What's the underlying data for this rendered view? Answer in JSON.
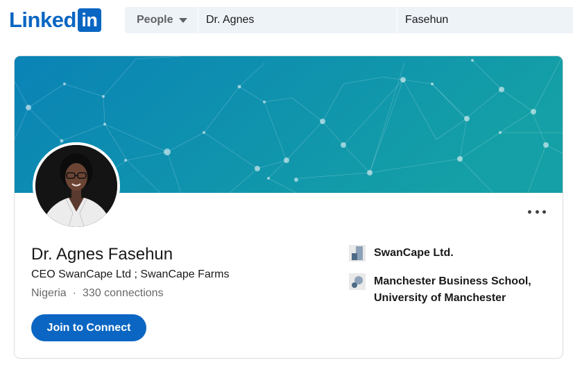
{
  "colors": {
    "brand": "#0a66c2",
    "search_bg": "#eef3f8",
    "banner_dark": "#0a83b6",
    "banner_light": "#14a0a6"
  },
  "header": {
    "logo_word": "Linked",
    "logo_box": "in",
    "search": {
      "category": "People",
      "first_name": "Dr. Agnes",
      "last_name": "Fasehun"
    }
  },
  "profile": {
    "name": "Dr. Agnes Fasehun",
    "headline": "CEO SwanCape Ltd ; SwanCape Farms",
    "location": "Nigeria",
    "separator": "·",
    "connections": "330 connections",
    "join_label": "Join to Connect",
    "more_icon": "ellipsis-icon"
  },
  "experience": [
    {
      "label": "SwanCape Ltd.",
      "icon": "company-logo-icon"
    },
    {
      "label_line1": "Manchester Business School,",
      "label_line2": "University of Manchester",
      "icon": "school-logo-icon"
    }
  ]
}
